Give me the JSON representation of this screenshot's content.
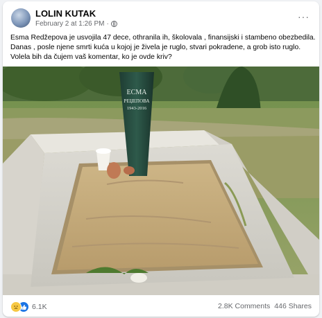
{
  "post": {
    "author": "LOLIN KUTAK",
    "timestamp": "February 2 at 1:26 PM",
    "visibility_icon": "globe-icon",
    "text_lines": [
      "Esma Redžepova je usvojila 47 dece, othranila ih, školovala , finansijski i stambeno obezbedila.",
      "Danas  , posle njene smrti kuća u kojoj je živela je ruglo, stvari pokradene, a grob isto ruglo.",
      "Volela bih da čujem vaš komentar, ko je ovde kriv?"
    ],
    "more_label": "···"
  },
  "photo": {
    "headstone_line1": "ЕСМА",
    "headstone_line2": "РЕЏЕПОВА",
    "headstone_line3": "1943-2016"
  },
  "footer": {
    "reaction_icons": [
      "sad-reaction-icon",
      "like-reaction-icon"
    ],
    "reaction_count": "6.1K",
    "comments": "2.8K Comments",
    "shares": "446 Shares"
  },
  "colors": {
    "text": "#050505",
    "secondary": "#65676b",
    "like_blue": "#1b74e4",
    "sad_yellow": "#f7c844"
  }
}
